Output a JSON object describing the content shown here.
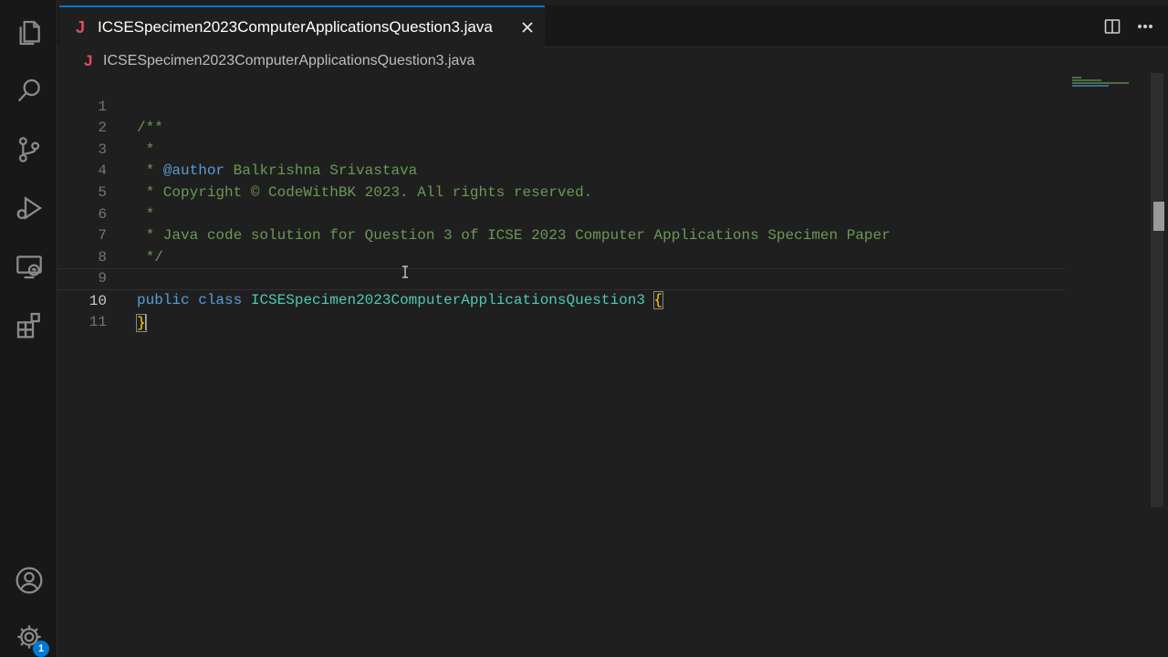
{
  "tab": {
    "icon_letter": "J",
    "label": "ICSESpecimen2023ComputerApplicationsQuestion3.java"
  },
  "breadcrumb": {
    "icon_letter": "J",
    "label": "ICSESpecimen2023ComputerApplicationsQuestion3.java"
  },
  "activity_bar": {
    "icons": [
      "explorer-icon",
      "search-icon",
      "source-control-icon",
      "run-debug-icon",
      "remote-explorer-icon",
      "extensions-icon",
      "account-icon",
      "settings-gear-icon"
    ],
    "settings_badge": "1"
  },
  "editor": {
    "active_line": 10,
    "lines": [
      {
        "n": "1",
        "text": "/**"
      },
      {
        "n": "2",
        "text": " *"
      },
      {
        "n": "3",
        "tag": "@author",
        "text_after_tag": " Balkrishna Srivastava"
      },
      {
        "n": "4",
        "text": " * Copyright © CodeWithBK 2023. All rights reserved."
      },
      {
        "n": "5",
        "text": " *"
      },
      {
        "n": "6",
        "text": " * Java code solution for Question 3 of ICSE 2023 Computer Applications Specimen Paper"
      },
      {
        "n": "7",
        "text": " */"
      },
      {
        "n": "8",
        "text": ""
      },
      {
        "n": "9",
        "kw1": "public",
        "kw2": "class",
        "cls": "ICSESpecimen2023ComputerApplicationsQuestion3",
        "brace": "{"
      },
      {
        "n": "10",
        "brace": "}"
      },
      {
        "n": "11",
        "text": ""
      }
    ]
  },
  "colors": {
    "background": "#1f1f1f",
    "comment": "#6a9955",
    "keyword": "#569cd6",
    "class_name": "#4ec9b0",
    "bracket": "#ffd700",
    "accent": "#0078d4"
  }
}
